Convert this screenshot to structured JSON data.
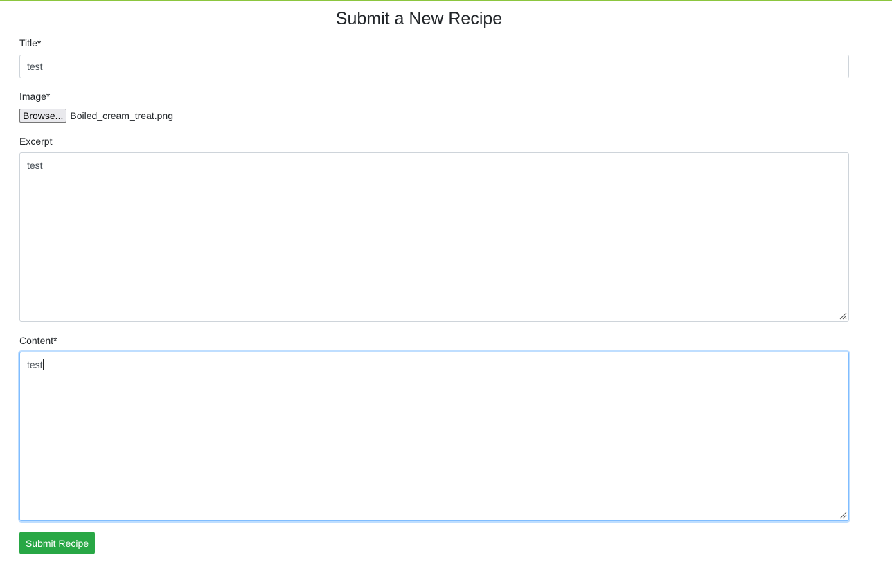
{
  "page": {
    "title": "Submit a New Recipe",
    "accent_color": "#8cc63f"
  },
  "form": {
    "title_field": {
      "label": "Title*",
      "value": "test"
    },
    "image_field": {
      "label": "Image*",
      "browse_label": "Browse...",
      "file_name": "Boiled_cream_treat.png"
    },
    "excerpt_field": {
      "label": "Excerpt",
      "value": "test"
    },
    "content_field": {
      "label": "Content*",
      "value": "test",
      "focused": true
    },
    "submit_label": "Submit Recipe",
    "submit_color": "#28a745"
  }
}
